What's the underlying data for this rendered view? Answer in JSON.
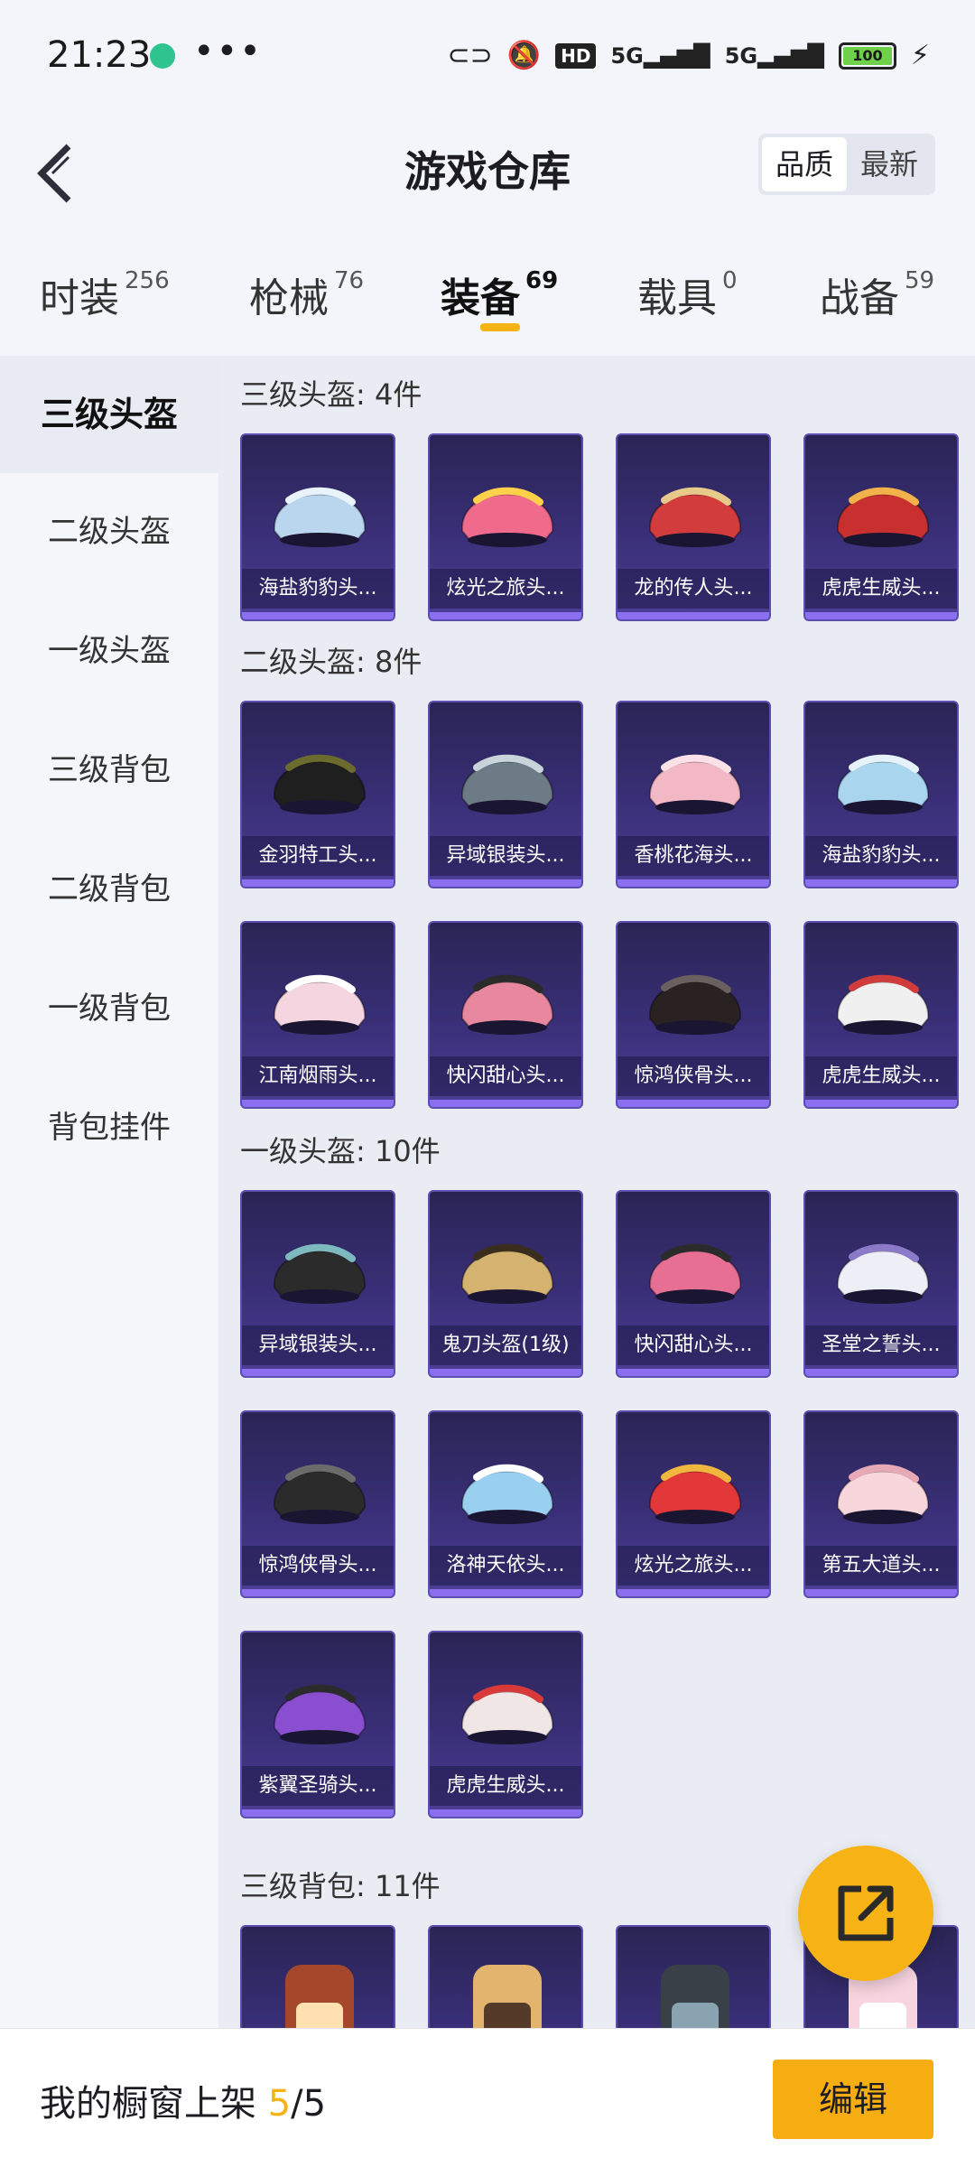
{
  "status_bar": {
    "time": "21:23",
    "dots": "•••",
    "hd": "HD",
    "sig1": "5G",
    "sig2": "5G",
    "battery": "100",
    "icons": [
      "link-icon",
      "mute-icon",
      "hd-icon",
      "signal-icon",
      "signal-icon",
      "battery-icon",
      "charging-icon"
    ]
  },
  "header": {
    "title": "游戏仓库",
    "sort_options": [
      "品质",
      "最新"
    ],
    "sort_active": "品质"
  },
  "tabs": [
    {
      "label": "时装",
      "count": "256"
    },
    {
      "label": "枪械",
      "count": "76"
    },
    {
      "label": "装备",
      "count": "69"
    },
    {
      "label": "载具",
      "count": "0"
    },
    {
      "label": "战备",
      "count": "59"
    }
  ],
  "active_tab": "装备",
  "sidebar": {
    "items": [
      "三级头盔",
      "二级头盔",
      "一级头盔",
      "三级背包",
      "二级背包",
      "一级背包",
      "背包挂件"
    ],
    "active": "三级头盔"
  },
  "sections": [
    {
      "title": "三级头盔: 4件",
      "items": [
        "海盐豹豹头...",
        "炫光之旅头...",
        "龙的传人头...",
        "虎虎生威头..."
      ]
    },
    {
      "title": "二级头盔: 8件",
      "items": [
        "金羽特工头...",
        "异域银装头...",
        "香桃花海头...",
        "海盐豹豹头...",
        "江南烟雨头...",
        "快闪甜心头...",
        "惊鸿侠骨头...",
        "虎虎生威头..."
      ]
    },
    {
      "title": "一级头盔: 10件",
      "items": [
        "异域银装头...",
        "鬼刀头盔(1级)",
        "快闪甜心头...",
        "圣堂之誓头...",
        "惊鸿侠骨头...",
        "洛神天依头...",
        "炫光之旅头...",
        "第五大道头...",
        "紫翼圣骑头...",
        "虎虎生威头..."
      ]
    },
    {
      "title": "三级背包: 11件",
      "items": [
        "",
        "",
        "",
        ""
      ]
    }
  ],
  "bottom_bar": {
    "label": "我的橱窗上架 ",
    "count_current": "5",
    "count_total": "/5",
    "edit_label": "编辑"
  },
  "colors": {
    "accent": "#f5b316",
    "card_bg": "#3a2f78",
    "card_border": "#5c4fb0"
  }
}
